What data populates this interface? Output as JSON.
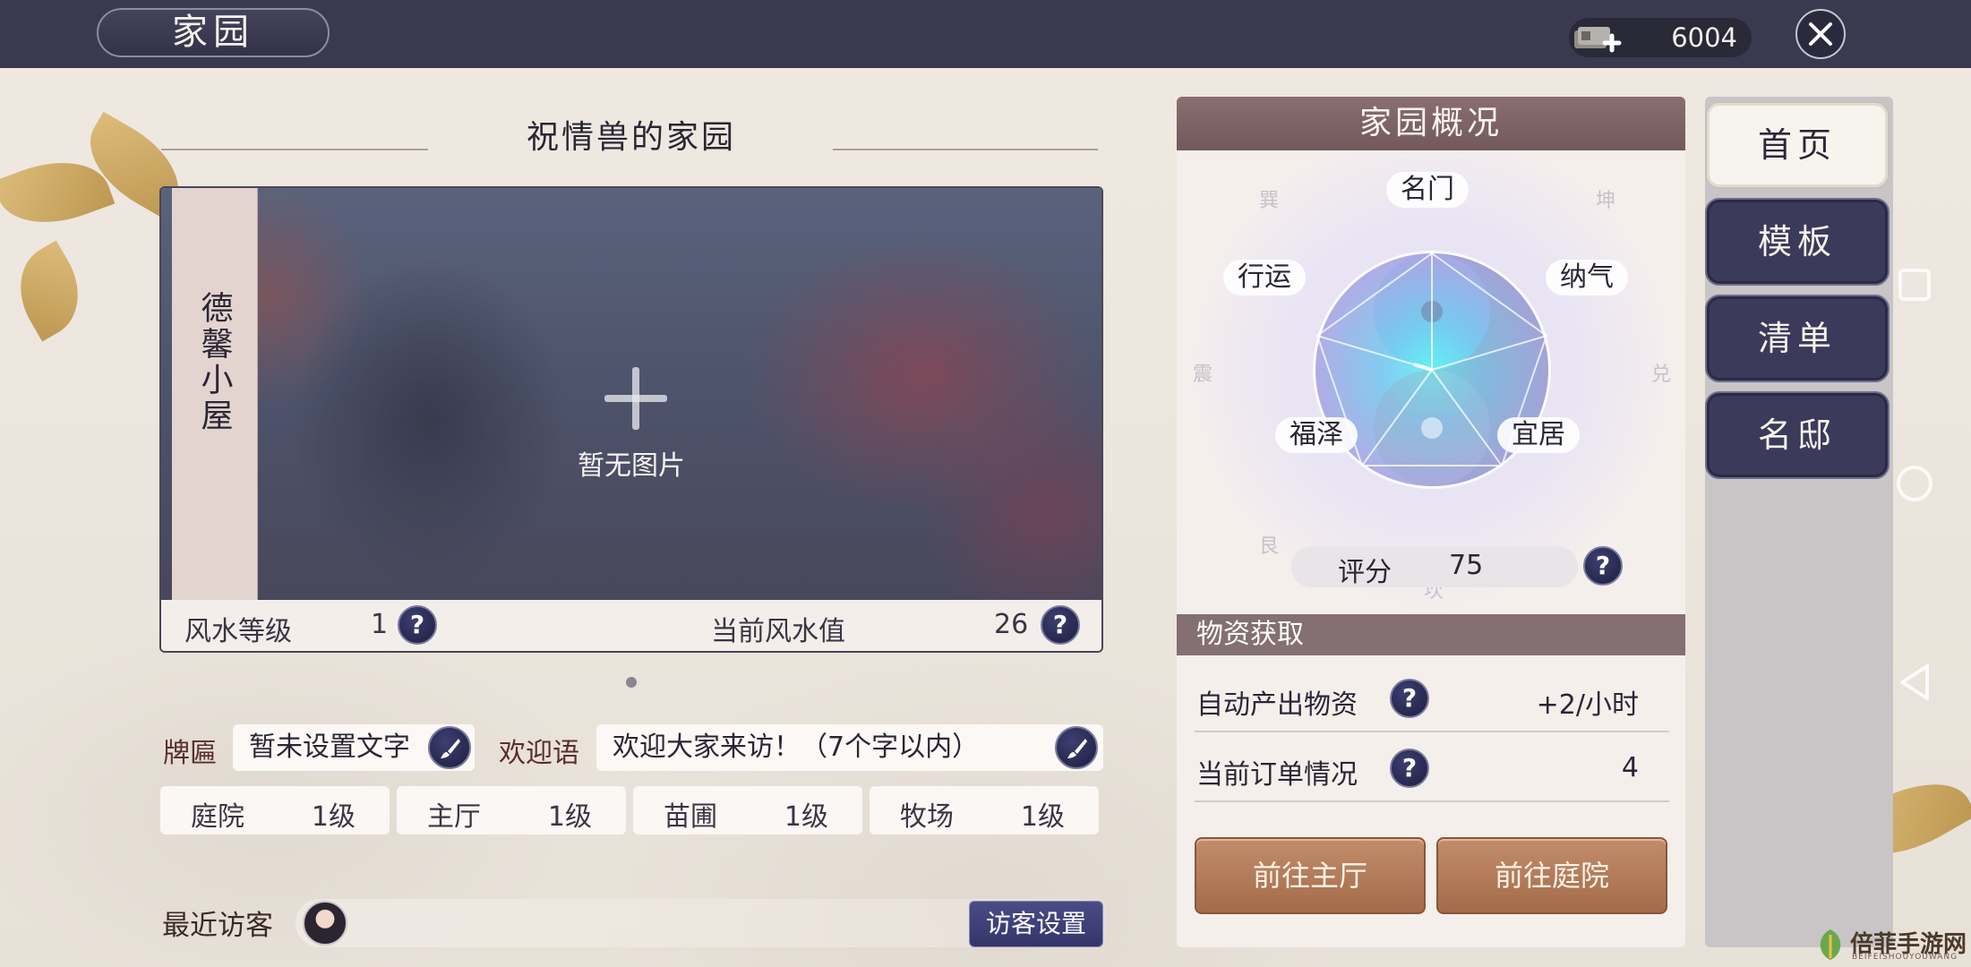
{
  "header": {
    "title": "家园",
    "currency_value": "6004"
  },
  "home": {
    "title": "祝情兽的家园",
    "house_name": "德馨小屋",
    "no_photo": "暂无图片",
    "fengshui_level_label": "风水等级",
    "fengshui_level_value": "1",
    "fengshui_value_label": "当前风水值",
    "fengshui_value": "26",
    "plaque_label": "牌匾",
    "plaque_value": "暂未设置文字",
    "welcome_label": "欢迎语",
    "welcome_value": "欢迎大家来访！（7个字以内）",
    "facilities": [
      {
        "name": "庭院",
        "level": "1级"
      },
      {
        "name": "主厅",
        "level": "1级"
      },
      {
        "name": "苗圃",
        "level": "1级"
      },
      {
        "name": "牧场",
        "level": "1级"
      }
    ],
    "visitors_label": "最近访客",
    "visitor_settings": "访客设置"
  },
  "overview": {
    "title": "家园概况",
    "nodes": {
      "top": "名门",
      "left": "行运",
      "right": "纳气",
      "bottom_left": "福泽",
      "bottom_right": "宜居"
    },
    "score_label": "评分",
    "score_value": "75",
    "trigrams": [
      "巽",
      "坤",
      "震",
      "兑",
      "艮",
      "坎"
    ],
    "resources_title": "物资获取",
    "auto_label": "自动产出物资",
    "auto_value": "+2/小时",
    "orders_label": "当前订单情况",
    "orders_value": "4",
    "go_hall": "前往主厅",
    "go_yard": "前往庭院"
  },
  "tabs": [
    "首页",
    "模板",
    "清单",
    "名邸"
  ],
  "watermark": {
    "text": "倍菲手游网",
    "sub": "BEIFEISHOUYOUWANG"
  },
  "colors": {
    "topbar": "#3b3950",
    "accent_button": "#a46b4b",
    "tab_dark": "#3b3a5b",
    "panel_header": "#846f72"
  },
  "icons": [
    "coin-add-icon",
    "close-icon",
    "plus-icon",
    "question-icon",
    "brush-edit-icon",
    "yin-yang-icon"
  ]
}
